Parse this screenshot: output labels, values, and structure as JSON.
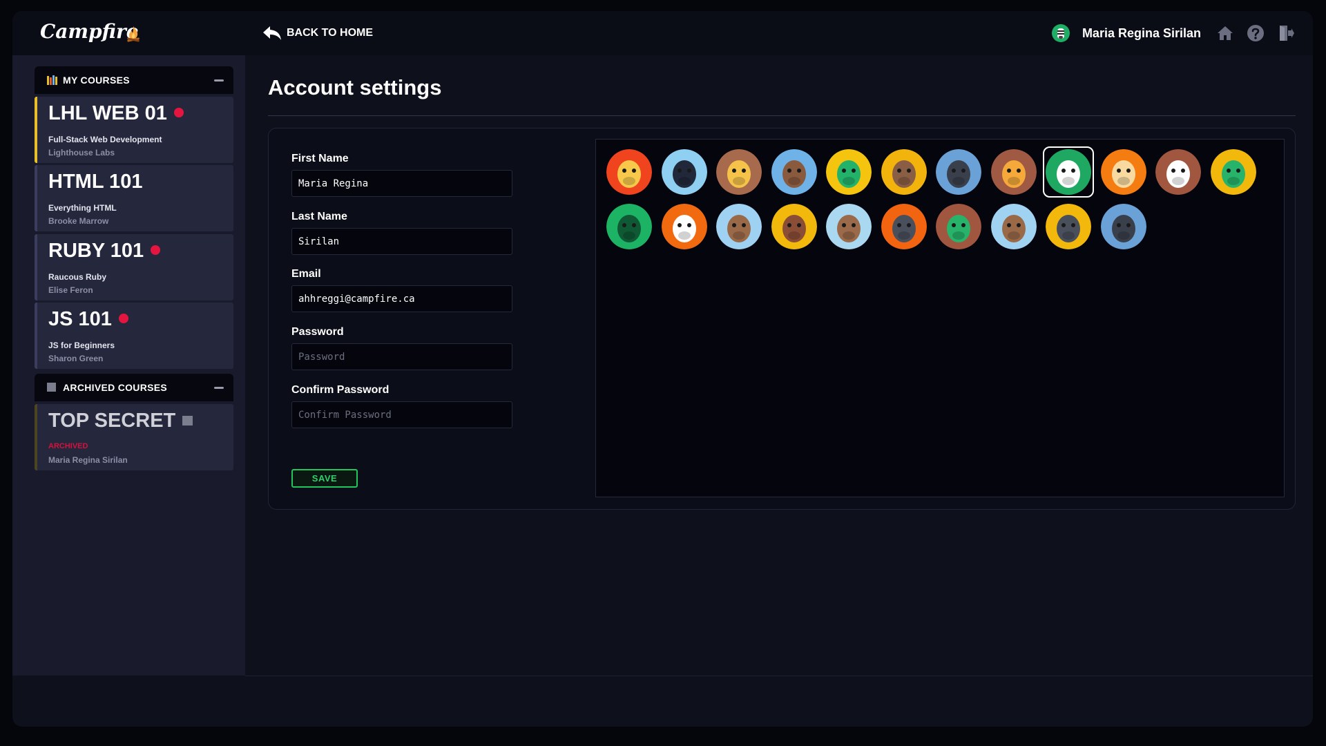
{
  "brand": {
    "name": "Campfire"
  },
  "sidebar": {
    "my_courses_label": "MY COURSES",
    "archived_label": "ARCHIVED COURSES",
    "courses": [
      {
        "code": "LHL WEB 01",
        "name": "Full-Stack Web Development",
        "teacher": "Lighthouse Labs",
        "notification": true,
        "active": true
      },
      {
        "code": "HTML 101",
        "name": "Everything HTML",
        "teacher": "Brooke Marrow",
        "notification": false
      },
      {
        "code": "RUBY 101",
        "name": "Raucous Ruby",
        "teacher": "Elise Feron",
        "notification": true
      },
      {
        "code": "JS 101",
        "name": "JS for Beginners",
        "teacher": "Sharon Green",
        "notification": true
      }
    ],
    "archived": [
      {
        "code": "TOP SECRET",
        "status": "ARCHIVED",
        "teacher": "Maria Regina Sirilan"
      }
    ]
  },
  "topbar": {
    "back_label": "BACK TO HOME",
    "user_name": "Maria Regina Sirilan",
    "icons": [
      "home-icon",
      "help-icon",
      "logout-icon"
    ]
  },
  "page": {
    "title": "Account settings"
  },
  "form": {
    "first_name_label": "First Name",
    "first_name": "Maria Regina",
    "last_name_label": "Last Name",
    "last_name": "Sirilan",
    "email_label": "Email",
    "email": "ahhreggi@campfire.ca",
    "password_label": "Password",
    "password_placeholder": "Password",
    "confirm_label": "Confirm Password",
    "confirm_placeholder": "Confirm Password",
    "save_label": "SAVE"
  },
  "avatars": {
    "selected": "zebra",
    "items": [
      {
        "id": "pufferfish",
        "bg": "#f0441f"
      },
      {
        "id": "penguin",
        "bg": "#8fd0f2"
      },
      {
        "id": "giraffe",
        "bg": "#a86a4c"
      },
      {
        "id": "bear",
        "bg": "#6fb2e8"
      },
      {
        "id": "parrot",
        "bg": "#f5c40f"
      },
      {
        "id": "sloth",
        "bg": "#f2b30c"
      },
      {
        "id": "gorilla",
        "bg": "#6aa2d8"
      },
      {
        "id": "fox",
        "bg": "#a05a44"
      },
      {
        "id": "zebra",
        "bg": "#1fa862"
      },
      {
        "id": "lion",
        "bg": "#f57c10"
      },
      {
        "id": "eagle",
        "bg": "#a0563f"
      },
      {
        "id": "snake",
        "bg": "#f2b80c"
      },
      {
        "id": "dragonfly",
        "bg": "#1db365"
      },
      {
        "id": "cow",
        "bg": "#f26a10"
      },
      {
        "id": "monkey",
        "bg": "#9fd2f2"
      },
      {
        "id": "boar",
        "bg": "#f2b80c"
      },
      {
        "id": "turtle",
        "bg": "#a9d8f0"
      },
      {
        "id": "wolf",
        "bg": "#f26410"
      },
      {
        "id": "frog",
        "bg": "#a0563f"
      },
      {
        "id": "owl",
        "bg": "#a0d3f2"
      },
      {
        "id": "hippo",
        "bg": "#f2b80c"
      },
      {
        "id": "bat",
        "bg": "#6aa2d8"
      }
    ]
  },
  "colors": {
    "accent_green": "#22c55e",
    "notification_red": "#e4163f",
    "active_yellow": "#e8c12a"
  }
}
